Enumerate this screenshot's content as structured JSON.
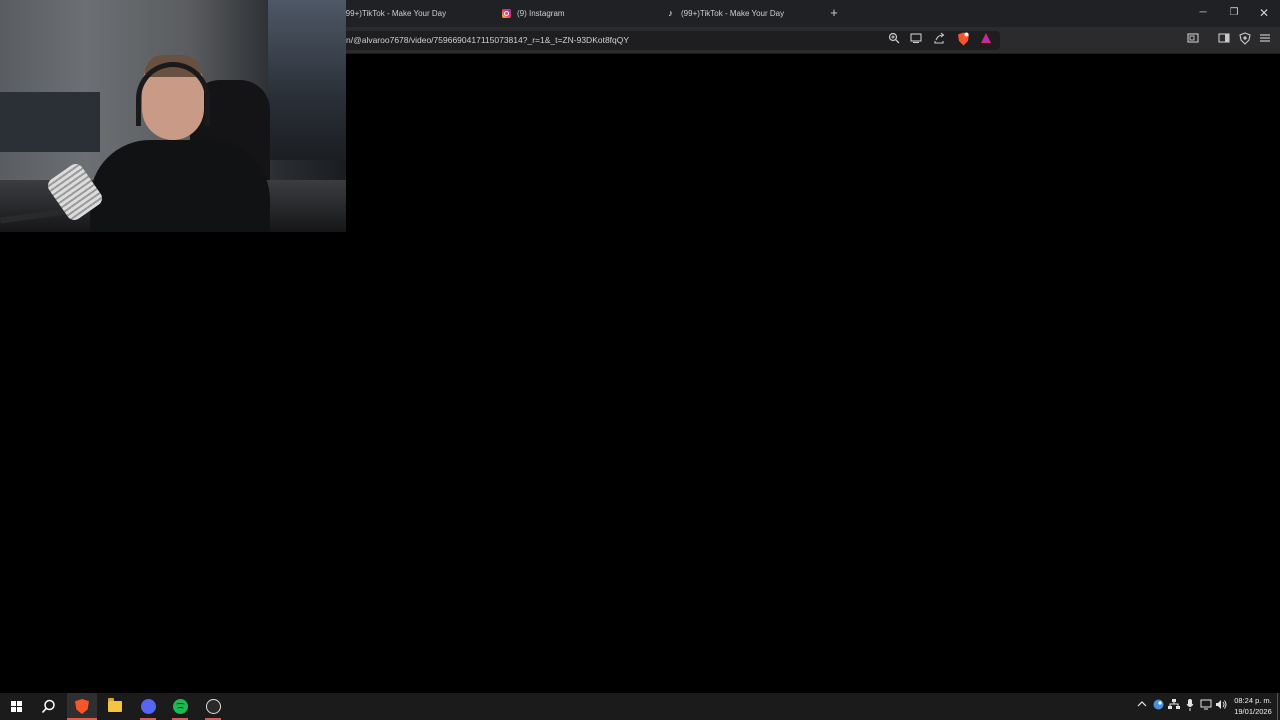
{
  "browser": {
    "tabs": [
      {
        "title": "(99+)TikTok - Make Your Day",
        "icon": "tiktok-icon"
      },
      {
        "title": "(9) Instagram",
        "icon": "instagram-icon"
      },
      {
        "title": "(99+)TikTok - Make Your Day",
        "icon": "tiktok-icon"
      }
    ],
    "new_tab_glyph": "+",
    "window_controls": {
      "minimize": "─",
      "restore": "❐",
      "close": "✕"
    },
    "url": "n/@alvaroo7678/video/7596690417115073814?_r=1&_t=ZN-93DKot8fqQY",
    "toolbar_icons": [
      "zoom-icon",
      "cast-icon",
      "share-icon",
      "brave-shields-icon",
      "brave-rewards-icon",
      "sidebar-icon",
      "panel-icon",
      "vpn-shield-icon",
      "menu-icon"
    ]
  },
  "taskbar": {
    "apps": [
      "start",
      "search",
      "brave",
      "file-explorer",
      "discord",
      "spotify",
      "obs"
    ],
    "clock_time": "08:24 p. m.",
    "clock_date": "19/01/2026"
  },
  "colors": {
    "browser_chrome": "#202124",
    "toolbar": "#2b2b2e",
    "content_bg": "#000000",
    "taskbar": "#1b1b1b",
    "brave_orange": "#fb542b"
  }
}
